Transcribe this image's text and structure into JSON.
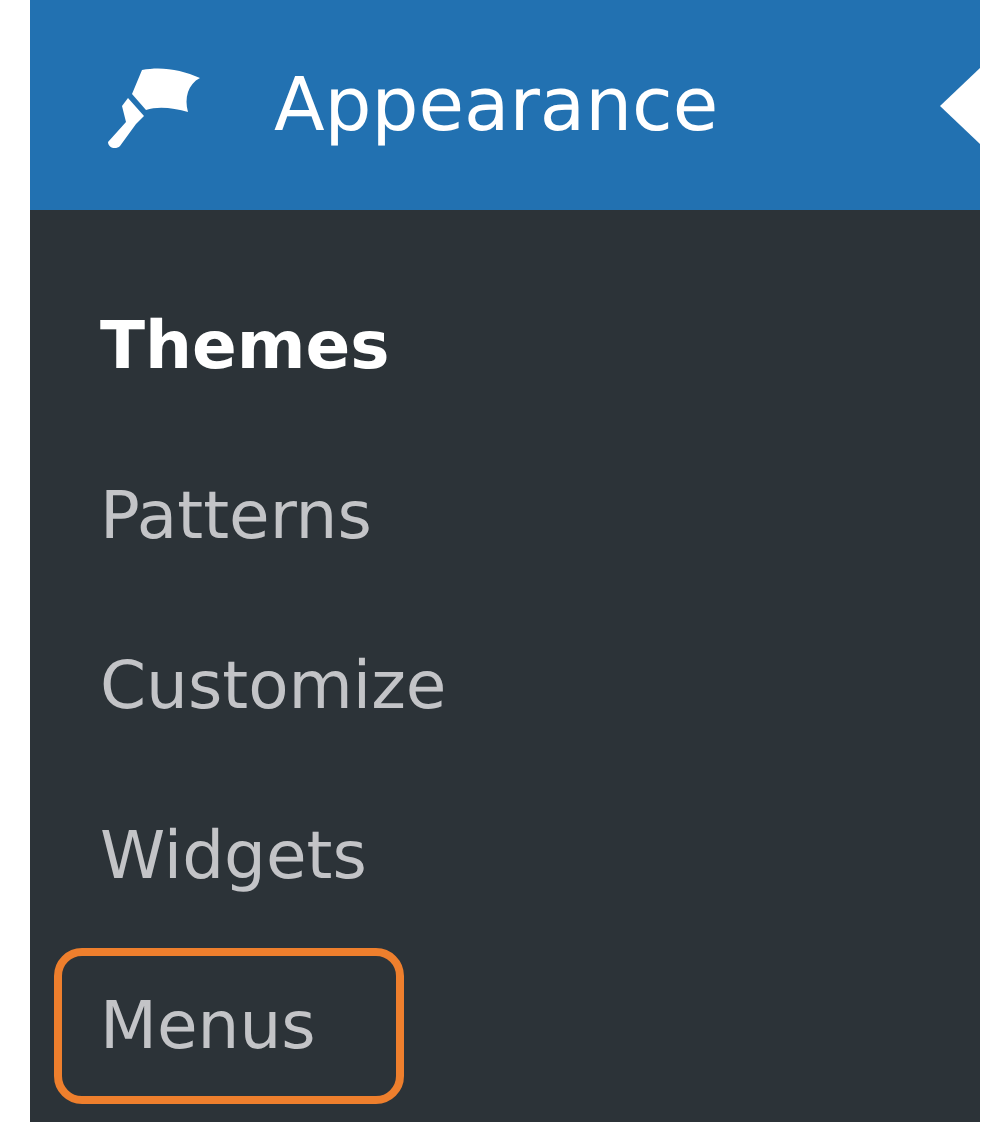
{
  "menu": {
    "title": "Appearance",
    "current": true
  },
  "submenu": [
    {
      "label": "Themes",
      "selected": true,
      "highlighted": false
    },
    {
      "label": "Patterns",
      "selected": false,
      "highlighted": false
    },
    {
      "label": "Customize",
      "selected": false,
      "highlighted": false
    },
    {
      "label": "Widgets",
      "selected": false,
      "highlighted": false
    },
    {
      "label": "Menus",
      "selected": false,
      "highlighted": true
    }
  ]
}
